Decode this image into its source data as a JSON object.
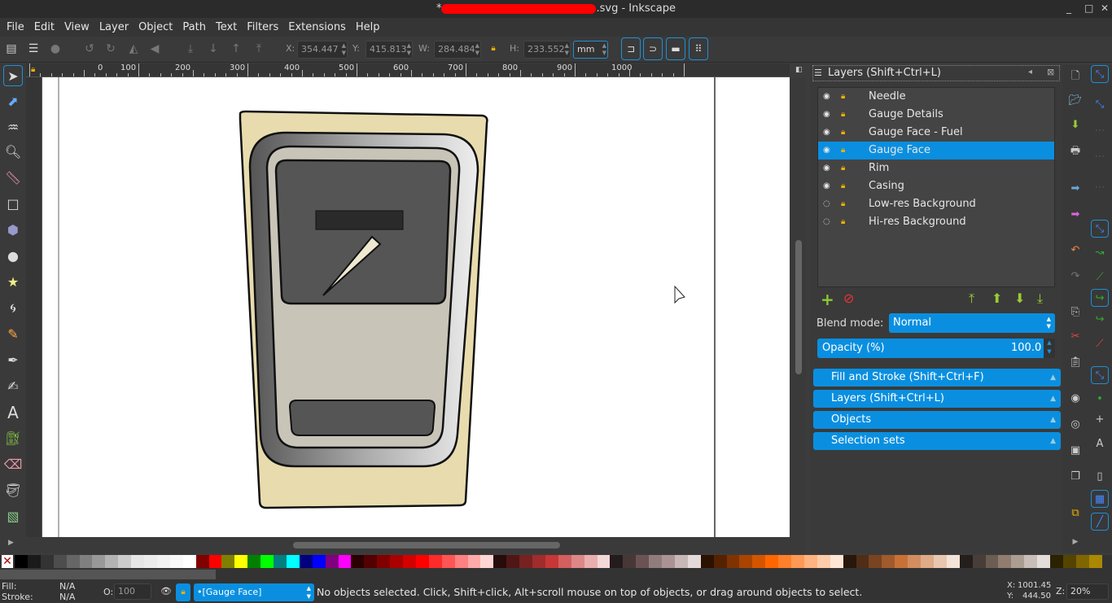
{
  "window": {
    "title_prefix": "*",
    "title_suffix": ".svg - Inkscape",
    "min": "_",
    "max": "□",
    "close": "✕"
  },
  "menu": [
    "File",
    "Edit",
    "View",
    "Layer",
    "Object",
    "Path",
    "Text",
    "Filters",
    "Extensions",
    "Help"
  ],
  "toolbar": {
    "x_label": "X:",
    "x": "354.447",
    "y_label": "Y:",
    "y": "415.813",
    "w_label": "W:",
    "w": "284.484",
    "h_label": "H:",
    "h": "233.552",
    "unit": "mm"
  },
  "ruler": {
    "labels": [
      "0",
      "100",
      "200",
      "300",
      "400",
      "500",
      "600",
      "700",
      "800",
      "900",
      "1000"
    ]
  },
  "layers_panel": {
    "title": "Layers (Shift+Ctrl+L)",
    "layers": [
      {
        "name": "Needle",
        "visible": true,
        "locked": true
      },
      {
        "name": "Gauge Details",
        "visible": true,
        "locked": false
      },
      {
        "name": "Gauge Face - Fuel",
        "visible": true,
        "locked": true
      },
      {
        "name": "Gauge Face",
        "visible": true,
        "locked": true,
        "selected": true
      },
      {
        "name": "Rim",
        "visible": true,
        "locked": true
      },
      {
        "name": "Casing",
        "visible": true,
        "locked": true
      },
      {
        "name": "Low-res Background",
        "visible": false,
        "locked": true
      },
      {
        "name": "Hi-res Background",
        "visible": false,
        "locked": true
      }
    ],
    "blend_label": "Blend mode:",
    "blend_value": "Normal",
    "opacity_label": "Opacity (%)",
    "opacity_value": "100.0"
  },
  "dock_sections": [
    "Fill and Stroke (Shift+Ctrl+F)",
    "Layers (Shift+Ctrl+L)",
    "Objects",
    "Selection sets"
  ],
  "palette": [
    "#000000",
    "#1a1a1a",
    "#333333",
    "#4d4d4d",
    "#666666",
    "#808080",
    "#999999",
    "#b3b3b3",
    "#cccccc",
    "#e6e6e6",
    "#ececec",
    "#f2f2f2",
    "#f9f9f9",
    "#ffffff",
    "#800000",
    "#ff0000",
    "#808000",
    "#ffff00",
    "#008000",
    "#00ff00",
    "#008080",
    "#00ffff",
    "#000080",
    "#0000ff",
    "#800080",
    "#ff00ff",
    "#2b0000",
    "#550000",
    "#800000",
    "#aa0000",
    "#d40000",
    "#ff0000",
    "#ff2a2a",
    "#ff5555",
    "#ff8080",
    "#ffaaaa",
    "#ffd5d5",
    "#280b0b",
    "#501616",
    "#782121",
    "#a02c2c",
    "#c83737",
    "#d35f5f",
    "#de8787",
    "#e9afaf",
    "#f4d7d7",
    "#241c1c",
    "#483737",
    "#6c5353",
    "#917c7c",
    "#ac9393",
    "#c8b7b7",
    "#e3dbdb",
    "#2b1100",
    "#552200",
    "#803300",
    "#aa4400",
    "#d45500",
    "#ff6600",
    "#ff7f2a",
    "#ff9955",
    "#ffb380",
    "#ffccaa",
    "#ffe6d5",
    "#28170b",
    "#502d16",
    "#784421",
    "#a05a2c",
    "#c87137",
    "#d38d5f",
    "#deaa87",
    "#e9c6af",
    "#f4e3d7",
    "#241f1c",
    "#483e37",
    "#6c5d53",
    "#917c6f",
    "#ac9d93",
    "#c8beb7",
    "#e3dedb",
    "#2b2200",
    "#554400",
    "#806600",
    "#aa8800"
  ],
  "status": {
    "fill_label": "Fill:",
    "fill": "N/A",
    "stroke_label": "Stroke:",
    "stroke": "N/A",
    "o_label": "O:",
    "opacity": "100",
    "layer": "•[Gauge Face]",
    "message": "No objects selected. Click, Shift+click, Alt+scroll mouse on top of objects, or drag around objects to select.",
    "x_label": "X:",
    "x": "1001.45",
    "y_label": "Y:",
    "y": "444.50",
    "z_label": "Z:",
    "zoom": "20%"
  }
}
